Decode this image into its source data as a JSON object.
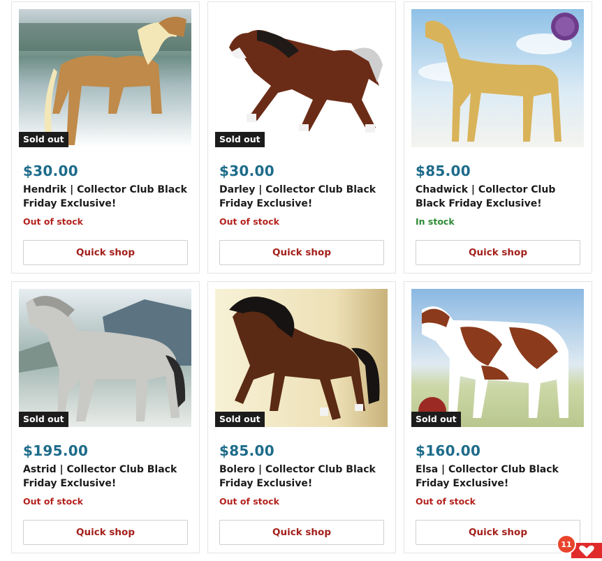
{
  "products": [
    {
      "price": "$30.00",
      "title": "Hendrik | Collector Club Black Friday Exclusive!",
      "stock": "Out of stock",
      "badge": "Sold out",
      "button": "Quick shop",
      "image": "palomino-draft-horse-lake"
    },
    {
      "price": "$30.00",
      "title": "Darley | Collector Club Black Friday Exclusive!",
      "stock": "Out of stock",
      "badge": "Sold out",
      "button": "Quick shop",
      "image": "bay-pinto-arabian"
    },
    {
      "price": "$85.00",
      "title": "Chadwick | Collector Club Black Friday Exclusive!",
      "stock": "In stock",
      "badge": "",
      "button": "Quick shop",
      "image": "golden-thoroughbred-sky"
    },
    {
      "price": "$195.00",
      "title": "Astrid | Collector Club Black Friday Exclusive!",
      "stock": "Out of stock",
      "badge": "Sold out",
      "button": "Quick shop",
      "image": "grey-dun-fjord-mountains"
    },
    {
      "price": "$85.00",
      "title": "Bolero | Collector Club Black Friday Exclusive!",
      "stock": "Out of stock",
      "badge": "Sold out",
      "button": "Quick shop",
      "image": "bay-andalusian-autumn"
    },
    {
      "price": "$160.00",
      "title": "Elsa | Collector Club Black Friday Exclusive!",
      "stock": "Out of stock",
      "badge": "Sold out",
      "button": "Quick shop",
      "image": "red-white-cow-field"
    }
  ],
  "floating": {
    "count": "11",
    "icon": "heart-icon"
  },
  "colors": {
    "price": "#1d6b8a",
    "out_of_stock": "#b4231f",
    "in_stock": "#2f8a36",
    "button_text": "#a3201b",
    "badge_bg": "#1c1c1c",
    "accent": "#e12b2b"
  }
}
